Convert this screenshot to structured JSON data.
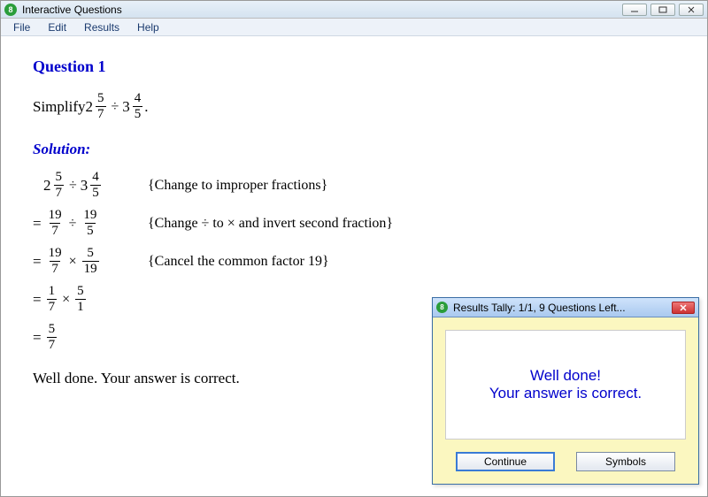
{
  "window": {
    "title": "Interactive Questions",
    "icon_glyph": "8"
  },
  "menu": {
    "file": "File",
    "edit": "Edit",
    "results": "Results",
    "help": "Help"
  },
  "question": {
    "title": "Question 1",
    "prompt_prefix": "Simplify ",
    "mixed1_whole": "2",
    "mixed1_num": "5",
    "mixed1_den": "7",
    "div_sym": "÷",
    "mixed2_whole": "3",
    "mixed2_num": "4",
    "mixed2_den": "5",
    "period": "."
  },
  "solution_label": "Solution:",
  "steps": [
    {
      "prefix": "",
      "lhs_mixed1_whole": "2",
      "lhs_mixed1_num": "5",
      "lhs_mixed1_den": "7",
      "op": "÷",
      "rhs_mixed2_whole": "3",
      "rhs_mixed2_num": "4",
      "rhs_mixed2_den": "5",
      "note": "{Change to improper fractions}"
    },
    {
      "prefix": "=",
      "f1_num": "19",
      "f1_den": "7",
      "op": "÷",
      "f2_num": "19",
      "f2_den": "5",
      "note": "{Change ÷ to × and invert second fraction}"
    },
    {
      "prefix": "=",
      "f1_num": "19",
      "f1_den": "7",
      "op": "×",
      "f2_num": "5",
      "f2_den": "19",
      "note": "{Cancel the common factor 19}"
    },
    {
      "prefix": "=",
      "f1_num": "1",
      "f1_den": "7",
      "op": "×",
      "f2_num": "5",
      "f2_den": "1",
      "note": ""
    },
    {
      "prefix": "=",
      "f1_num": "5",
      "f1_den": "7",
      "note": ""
    }
  ],
  "feedback": "Well done.  Your answer is correct.",
  "popup": {
    "title": "Results Tally: 1/1, 9 Questions Left...",
    "icon_glyph": "8",
    "msg_line1": "Well done!",
    "msg_line2": "Your answer is correct.",
    "continue": "Continue",
    "symbols": "Symbols"
  }
}
